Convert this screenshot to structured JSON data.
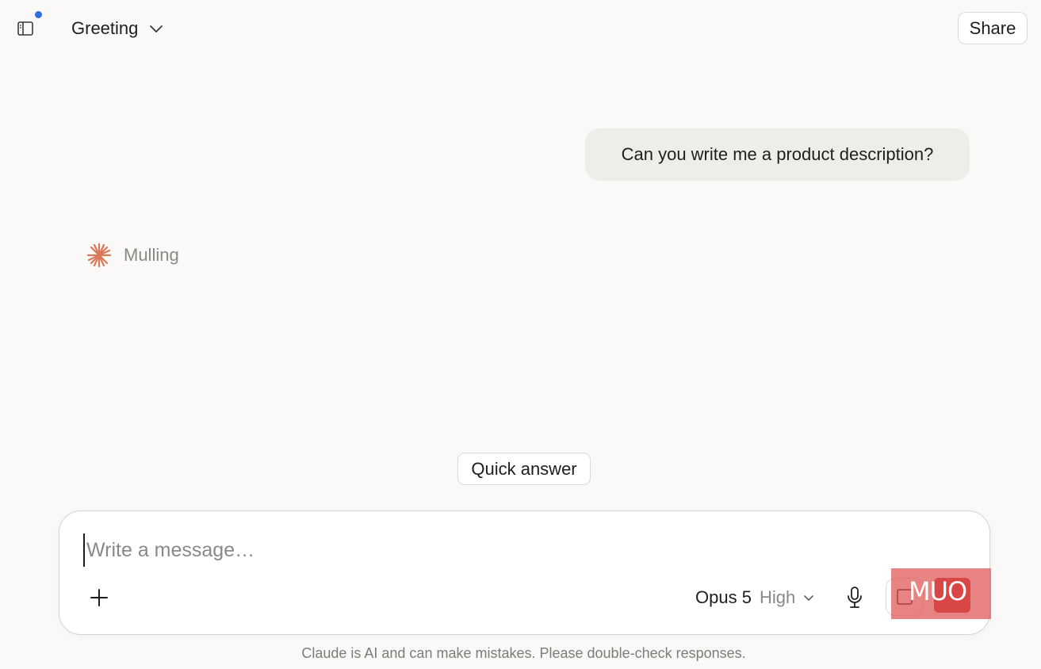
{
  "topbar": {
    "sidebar_toggle_icon": "sidebar-icon",
    "conversation_title": "Greeting",
    "share_label": "Share",
    "notification_color": "#2f6fdc"
  },
  "conversation": {
    "user_message": "Can you write me a product description?",
    "assistant_status": "Mulling",
    "assistant_icon": "spark-icon",
    "accent_color": "#d97757"
  },
  "quick_answer_label": "Quick answer",
  "composer": {
    "placeholder": "Write a message…",
    "value": "",
    "model_name": "Opus 5",
    "model_effort": "High",
    "attach_icon": "plus-icon",
    "mic_icon": "microphone-icon",
    "stop_icon": "stop-icon"
  },
  "watermark": {
    "text": "MUO"
  },
  "footer": {
    "disclaimer": "Claude is AI and can make mistakes. Please double-check responses."
  }
}
